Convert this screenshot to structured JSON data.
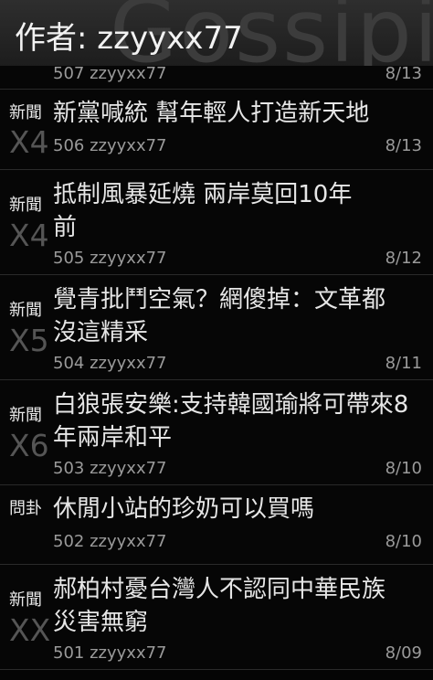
{
  "header": {
    "label": "作者:",
    "author": "zzyyxx77",
    "watermark": "Gossiping"
  },
  "articles": [
    {
      "number": "507",
      "author": "zzyyxx77",
      "date": "8/13",
      "category": "",
      "push": "",
      "title": ""
    },
    {
      "number": "506",
      "author": "zzyyxx77",
      "date": "8/13",
      "category": "新聞",
      "push": "X4",
      "title": "新黨喊統 幫年輕人打造新天地"
    },
    {
      "number": "505",
      "author": "zzyyxx77",
      "date": "8/12",
      "category": "新聞",
      "push": "X4",
      "title": "抵制風暴延燒 兩岸莫回10年前"
    },
    {
      "number": "504",
      "author": "zzyyxx77",
      "date": "8/11",
      "category": "新聞",
      "push": "X5",
      "title": "覺青批鬥空氣？網傻掉：文革都沒這精采"
    },
    {
      "number": "503",
      "author": "zzyyxx77",
      "date": "8/10",
      "category": "新聞",
      "push": "X6",
      "title": "白狼張安樂:支持韓國瑜將可帶來8年兩岸和平"
    },
    {
      "number": "502",
      "author": "zzyyxx77",
      "date": "8/10",
      "category": "問卦",
      "push": "",
      "title": "休閒小站的珍奶可以買嗎"
    },
    {
      "number": "501",
      "author": "zzyyxx77",
      "date": "8/09",
      "category": "新聞",
      "push": "XX",
      "title": "郝柏村憂台灣人不認同中華民族 災害無窮"
    }
  ]
}
